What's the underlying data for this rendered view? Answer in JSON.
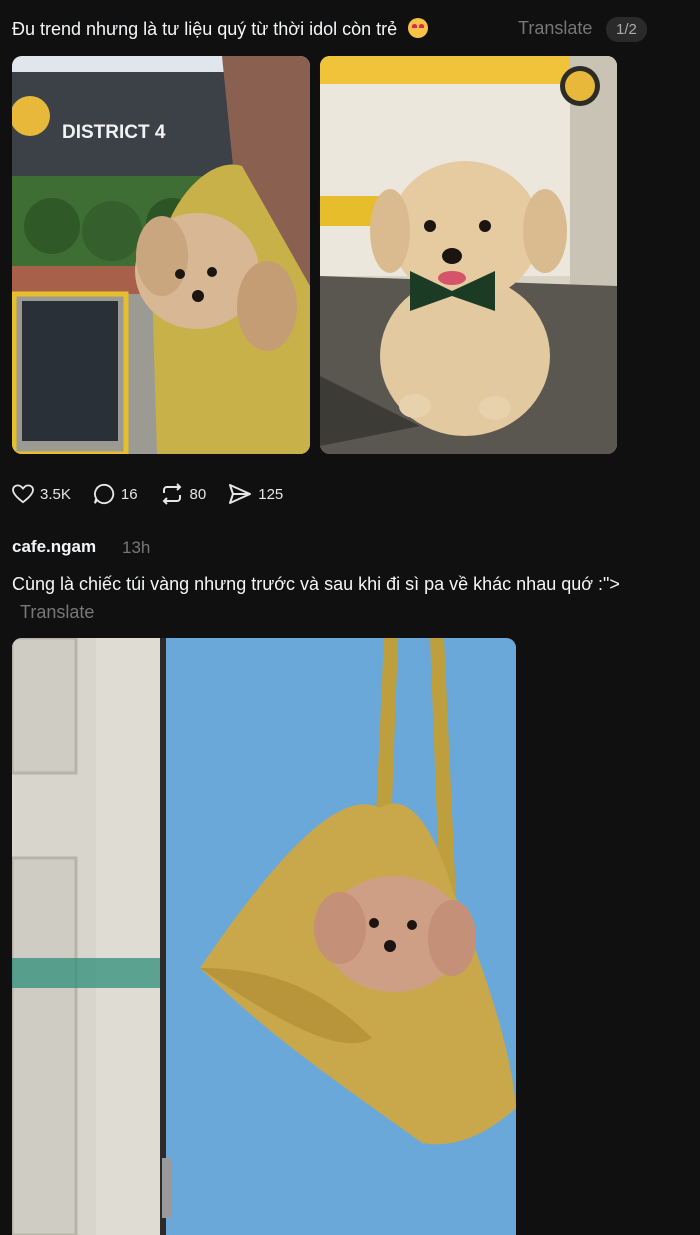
{
  "post1": {
    "caption": "Đu trend nhưng là tư liệu quý từ thời idol còn trẻ",
    "translate_label": "Translate",
    "pager": "1/2",
    "emoji_icon": "heart-eyes-emoji-icon",
    "photo1_brand": "DISTRICT 4",
    "stats": {
      "likes": "3.5K",
      "comments": "16",
      "reposts": "80",
      "shares": "125"
    }
  },
  "post2": {
    "username": "cafe.ngam",
    "time": "13h",
    "text": "Cùng là chiếc túi vàng nhưng trước và sau khi đi sì pa về khác nhau quớ :\">",
    "translate_label": "Translate"
  },
  "colors": {
    "background": "#101010",
    "text": "#f3f5f7",
    "muted": "#777777"
  }
}
